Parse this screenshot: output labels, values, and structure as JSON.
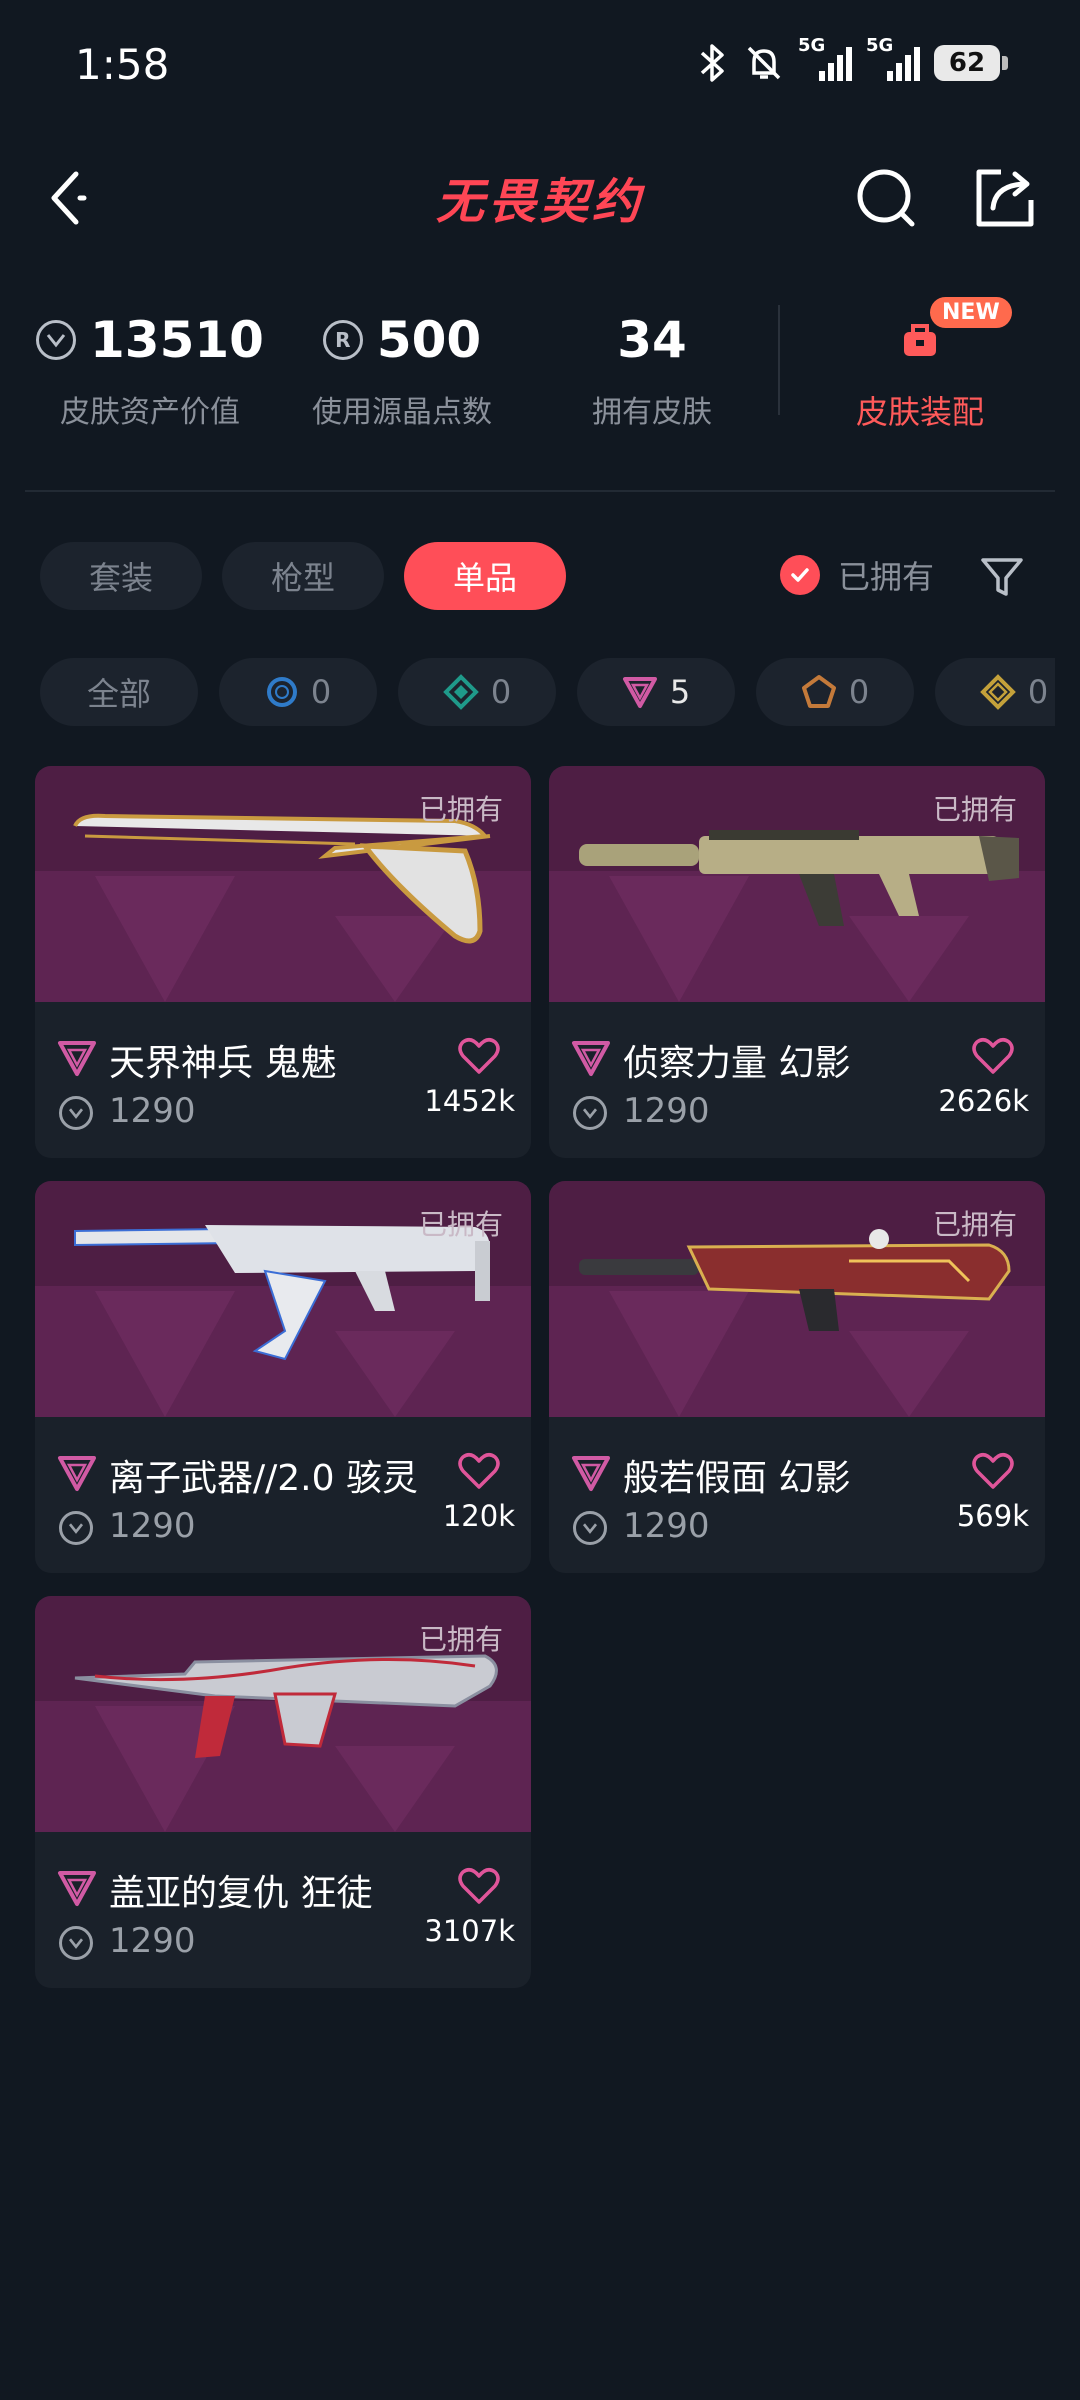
{
  "status_bar": {
    "time": "1:58",
    "net1": "5G",
    "net2": "5G",
    "battery": "62"
  },
  "header": {
    "logo": "无畏契约"
  },
  "stats": {
    "asset_value": "13510",
    "asset_label": "皮肤资产价值",
    "radianite": "500",
    "radianite_label": "使用源晶点数",
    "skins_owned": "34",
    "skins_label": "拥有皮肤",
    "outfit_label": "皮肤装配",
    "new_badge": "NEW"
  },
  "tabs": [
    "套装",
    "枪型",
    "单品"
  ],
  "owned_toggle": "已拥有",
  "rarity_filters": [
    {
      "label": "全部",
      "count": ""
    },
    {
      "count": "0",
      "color": "#2f7bc9"
    },
    {
      "count": "0",
      "color": "#1f9a8a"
    },
    {
      "count": "5",
      "color": "#d15aa4"
    },
    {
      "count": "0",
      "color": "#c47a3a"
    },
    {
      "count": "0",
      "color": "#c4a13a"
    }
  ],
  "skins": [
    {
      "owned": "已拥有",
      "name": "天界神兵 鬼魅",
      "price": "1290",
      "likes": "1452k"
    },
    {
      "owned": "已拥有",
      "name": "侦察力量 幻影",
      "price": "1290",
      "likes": "2626k"
    },
    {
      "owned": "已拥有",
      "name": "离子武器//2.0 骇灵",
      "price": "1290",
      "likes": "120k"
    },
    {
      "owned": "已拥有",
      "name": "般若假面 幻影",
      "price": "1290",
      "likes": "569k"
    },
    {
      "owned": "已拥有",
      "name": "盖亚的复仇 狂徒",
      "price": "1290",
      "likes": "3107k"
    }
  ],
  "colors": {
    "accent": "#ff4e58",
    "background": "#111821",
    "tier": "#d15aa4"
  }
}
